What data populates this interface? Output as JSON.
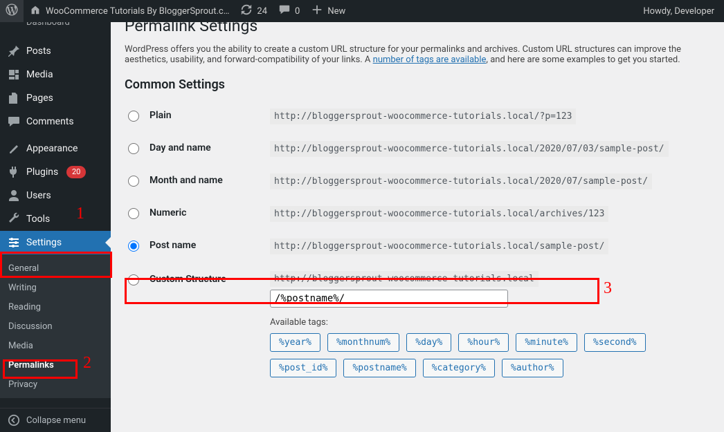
{
  "adminbar": {
    "site_title": "WooCommerce Tutorials By BloggerSprout.c…",
    "updates_count": "24",
    "comments_count": "0",
    "new_label": "New",
    "howdy": "Howdy, Developer"
  },
  "sidebar": {
    "dashboard_cut": "Dashboard",
    "items": [
      {
        "label": "Posts"
      },
      {
        "label": "Media"
      },
      {
        "label": "Pages"
      },
      {
        "label": "Comments"
      },
      {
        "label": "Appearance"
      },
      {
        "label": "Plugins",
        "badge": "20"
      },
      {
        "label": "Users"
      },
      {
        "label": "Tools"
      },
      {
        "label": "Settings"
      }
    ],
    "submenu": {
      "items": [
        "General",
        "Writing",
        "Reading",
        "Discussion",
        "Media",
        "Permalinks",
        "Privacy"
      ]
    },
    "collapse": "Collapse menu"
  },
  "page": {
    "title": "Permalink Settings",
    "intro_a": "WordPress offers you the ability to create a custom URL structure for your permalinks and archives. Custom URL structures can improve the aesthetics, usability, and forward-compatibility of your links. A ",
    "intro_link": "number of tags are available",
    "intro_b": ", and here are some examples to get you started.",
    "common_heading": "Common Settings",
    "options": {
      "plain": {
        "label": "Plain",
        "url": "http://bloggersprout-woocommerce-tutorials.local/?p=123"
      },
      "dayname": {
        "label": "Day and name",
        "url": "http://bloggersprout-woocommerce-tutorials.local/2020/07/03/sample-post/"
      },
      "monthname": {
        "label": "Month and name",
        "url": "http://bloggersprout-woocommerce-tutorials.local/2020/07/sample-post/"
      },
      "numeric": {
        "label": "Numeric",
        "url": "http://bloggersprout-woocommerce-tutorials.local/archives/123"
      },
      "postname": {
        "label": "Post name",
        "url": "http://bloggersprout-woocommerce-tutorials.local/sample-post/"
      },
      "custom": {
        "label": "Custom Structure",
        "prefix": "http://bloggersprout-woocommerce-tutorials.local",
        "value": "/%postname%/"
      }
    },
    "available_tags_label": "Available tags:",
    "tags": [
      "%year%",
      "%monthnum%",
      "%day%",
      "%hour%",
      "%minute%",
      "%second%",
      "%post_id%",
      "%postname%",
      "%category%",
      "%author%"
    ]
  },
  "annotations": {
    "n1": "1",
    "n2": "2",
    "n3": "3"
  }
}
